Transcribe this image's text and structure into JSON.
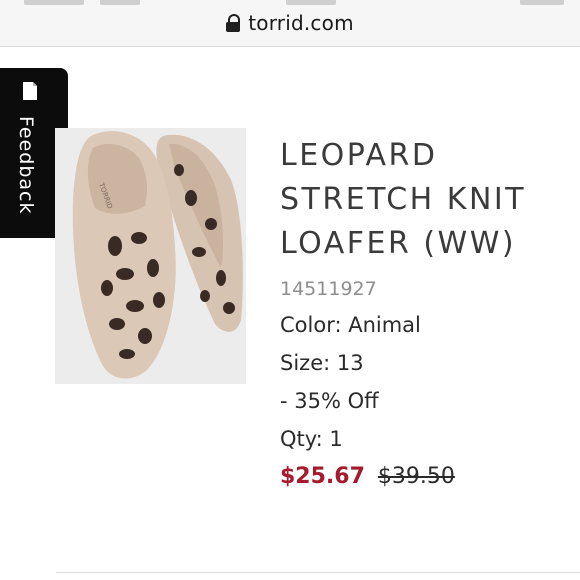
{
  "browser": {
    "url": "torrid.com"
  },
  "feedback": {
    "label": "Feedback"
  },
  "product": {
    "title_lines": [
      "LEOPARD",
      "STRETCH KNIT",
      "LOAFER (WW)"
    ],
    "sku": "14511927",
    "color": "Color: Animal",
    "size": "Size: 13",
    "discount": "- 35% Off",
    "qty": "Qty: 1",
    "sale_price": "$25.67",
    "original_price": "$39.50",
    "image_brand_text": "TORRID"
  },
  "colors": {
    "sale": "#a6192e",
    "feedback_bg": "#0c0c0c"
  }
}
